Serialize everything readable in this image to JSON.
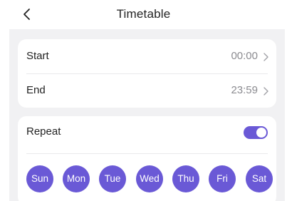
{
  "header": {
    "title": "Timetable",
    "back_icon": "chevron-left-icon"
  },
  "schedule": {
    "start": {
      "label": "Start",
      "value": "00:00"
    },
    "end": {
      "label": "End",
      "value": "23:59"
    }
  },
  "repeat": {
    "label": "Repeat",
    "enabled": true,
    "days": [
      "Sun",
      "Mon",
      "Tue",
      "Wed",
      "Thu",
      "Fri",
      "Sat"
    ]
  },
  "colors": {
    "accent": "#6a59d6",
    "background": "#f1f1f3",
    "card": "#ffffff",
    "secondary_text": "#8b8b90"
  }
}
